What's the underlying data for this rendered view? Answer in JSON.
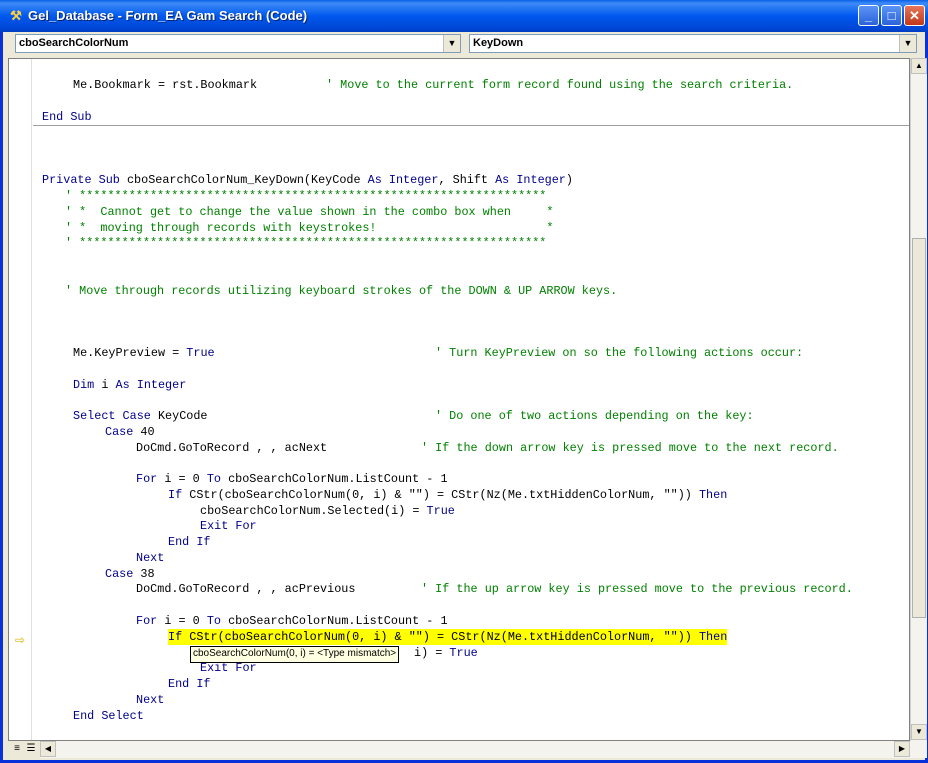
{
  "window": {
    "title": "Gel_Database - Form_EA Gam Search (Code)",
    "icon": "vba-editor-icon",
    "controls": {
      "minimize": "_",
      "maximize": "□",
      "close": "✕"
    }
  },
  "object_combo": {
    "value": "cboSearchColorNum"
  },
  "procedure_combo": {
    "value": "KeyDown"
  },
  "code": {
    "l1a": "Me.Bookmark = rst.Bookmark",
    "l1b": "' Move to the current form record found using the search criteria.",
    "l2": "End Sub",
    "l3a": "Private Sub ",
    "l3b": "cboSearchColorNum_KeyDown(KeyCode ",
    "l3c": "As Integer",
    "l3d": ", Shift ",
    "l3e": "As Integer",
    "l3f": ")",
    "c1": "' ******************************************************************",
    "c2": "' *  Cannot get to change the value shown in the combo box when     *",
    "c3": "' *  moving through records with keystrokes!                        *",
    "c4": "' ******************************************************************",
    "c5": "' Move through records utilizing keyboard strokes of the DOWN & UP ARROW keys.",
    "l4a": "Me.KeyPreview = ",
    "l4b": "True",
    "l4c": "' Turn KeyPreview on so the following actions occur:",
    "l5a": "Dim",
    "l5b": " i ",
    "l5c": "As Integer",
    "l6a": "Select Case",
    "l6b": " KeyCode",
    "l6c": "' Do one of two actions depending on the key:",
    "l7a": "Case",
    "l7b": " 40",
    "l8a": "DoCmd.GoToRecord , , acNext",
    "l8b": "' If the down arrow key is pressed move to the next record.",
    "l9a": "For",
    "l9b": " i = 0 ",
    "l9c": "To",
    "l9d": " cboSearchColorNum.ListCount - 1",
    "l10a": "If",
    "l10b": " CStr(cboSearchColorNum(0, i) & \"\") = CStr(Nz(Me.txtHiddenColorNum, \"\")) ",
    "l10c": "Then",
    "l11a": "cboSearchColorNum.Selected(i) = ",
    "l11b": "True",
    "l12": "Exit For",
    "l13": "End If",
    "l14": "Next",
    "l15a": "Case",
    "l15b": " 38",
    "l16a": "DoCmd.GoToRecord , , acPrevious",
    "l16b": "' If the up arrow key is pressed move to the previous record.",
    "l17a": "For",
    "l17b": " i = 0 ",
    "l17c": "To",
    "l17d": " cboSearchColorNum.ListCount - 1",
    "l18a": "If",
    "l18b": " CStr(cboSearchColorNum(0, i) & \"\") = CStr(Nz(Me.txtHiddenColorNum, \"\")) ",
    "l18c": "Then",
    "l19a": "i) = ",
    "l19b": "True",
    "l20": "Exit For",
    "l21": "End If",
    "l22": "Next",
    "l23": "End Select"
  },
  "tooltip": {
    "text": "cboSearchColorNum(0, i) = <Type mismatch>"
  },
  "execution_marker": "⇨"
}
